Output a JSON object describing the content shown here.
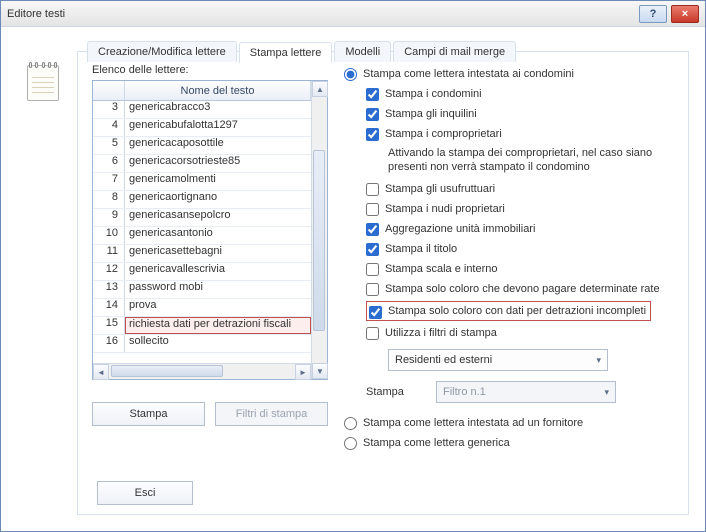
{
  "window": {
    "title": "Editore testi",
    "help_label": "?",
    "close_label": "×"
  },
  "tabs": {
    "items": [
      {
        "label": "Creazione/Modifica lettere"
      },
      {
        "label": "Stampa lettere"
      },
      {
        "label": "Modelli"
      },
      {
        "label": "Campi di mail merge"
      }
    ],
    "active_index": 1
  },
  "left": {
    "list_label": "Elenco delle lettere:",
    "header_num": "",
    "header_name": "Nome del testo",
    "rows": [
      {
        "n": "3",
        "name": "genericabracco3"
      },
      {
        "n": "4",
        "name": "genericabufalotta1297"
      },
      {
        "n": "5",
        "name": "genericacaposottile"
      },
      {
        "n": "6",
        "name": "genericacorsotrieste85"
      },
      {
        "n": "7",
        "name": "genericamolmenti"
      },
      {
        "n": "8",
        "name": "genericaortignano"
      },
      {
        "n": "9",
        "name": "genericasansepolcro"
      },
      {
        "n": "10",
        "name": "genericasantonio"
      },
      {
        "n": "11",
        "name": "genericasettebagni"
      },
      {
        "n": "12",
        "name": "genericavallescrivia"
      },
      {
        "n": "13",
        "name": "password mobi"
      },
      {
        "n": "14",
        "name": "prova"
      },
      {
        "n": "15",
        "name": "richiesta dati per detrazioni fiscali"
      },
      {
        "n": "16",
        "name": "sollecito"
      }
    ],
    "selected_index": 12,
    "btn_print": "Stampa",
    "btn_filters": "Filtri di stampa"
  },
  "right": {
    "radio_condomini": "Stampa come lettera intestata ai condomini",
    "cb_condomini": "Stampa i condomini",
    "cb_inquilini": "Stampa gli inquilini",
    "cb_comproprietari": "Stampa i comproprietari",
    "hint_comproprietari": "Attivando la stampa dei comproprietari, nel caso siano presenti non verrà stampato il condomino",
    "cb_usufruttuari": "Stampa gli usufruttuari",
    "cb_nudi": "Stampa i nudi proprietari",
    "cb_aggregazione": "Aggregazione unità immobiliari",
    "cb_titolo": "Stampa il titolo",
    "cb_scala": "Stampa scala e interno",
    "cb_rate": "Stampa solo coloro che devono pagare determinate rate",
    "cb_incompleti": "Stampa solo coloro con dati per detrazioni incompleti",
    "cb_filtri": "Utilizza i filtri di stampa",
    "select_residenti": "Residenti ed esterni",
    "stampa_label": "Stampa",
    "select_filtro": "Filtro n.1",
    "radio_fornitore": "Stampa come lettera intestata ad un fornitore",
    "radio_generica": "Stampa come lettera generica",
    "checked": {
      "condomini": true,
      "inquilini": true,
      "comproprietari": true,
      "usufruttuari": false,
      "nudi": false,
      "aggregazione": true,
      "titolo": true,
      "scala": false,
      "rate": false,
      "incompleti": true,
      "filtri": false
    },
    "radio_selected": "condomini"
  },
  "footer": {
    "exit": "Esci"
  }
}
